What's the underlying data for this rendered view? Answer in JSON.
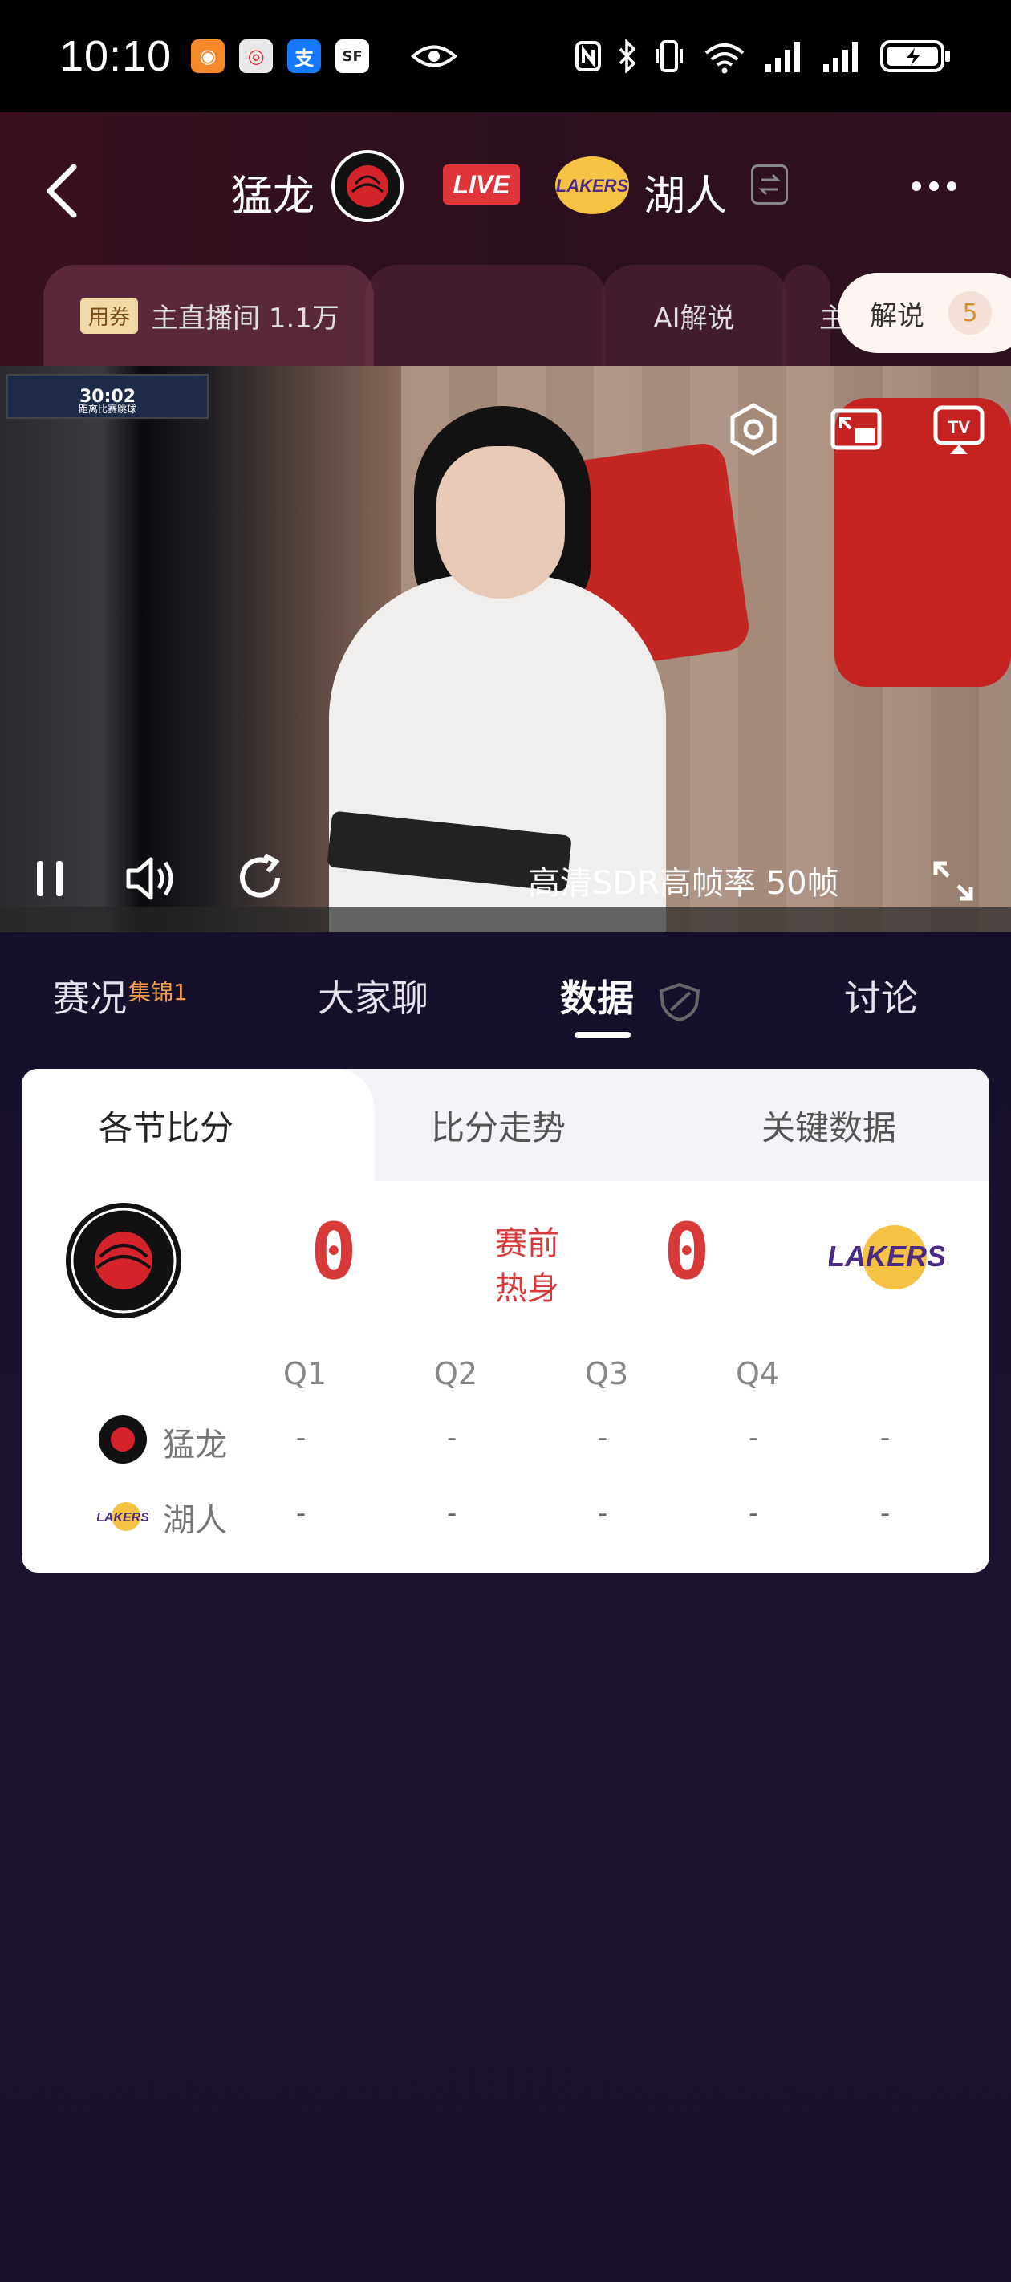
{
  "status_bar": {
    "time": "10:10",
    "notifications": [
      "app-icon-1",
      "weibo-icon",
      "alipay-icon",
      "sf-express-icon"
    ],
    "eye_icon": "eye-icon",
    "system_icons": [
      "nfc-icon",
      "bluetooth-icon",
      "vibrate-icon",
      "wifi-6-icon",
      "signal-icon",
      "signal-icon",
      "battery-charging-icon"
    ]
  },
  "header": {
    "home_team": "猛龙",
    "away_team": "湖人",
    "live_label": "LIVE",
    "raptors_logo_text": "TORONTO RAPTORS",
    "lakers_logo_text": "LAKERS"
  },
  "room_tabs": {
    "coupon": "用券",
    "main_room": "主直播间 1.1万",
    "ai": "AI解说",
    "partial": "主",
    "commentary": "解说",
    "commentary_count": "5"
  },
  "video": {
    "scorebug_clock": "30:02",
    "scorebug_sub": "距离比赛跳球",
    "quality": "高清SDR高帧率 50帧"
  },
  "content_tabs": [
    {
      "label": "赛况",
      "badge": "集锦1"
    },
    {
      "label": "大家聊"
    },
    {
      "label": "数据",
      "active": true
    },
    {
      "label": "讨论"
    }
  ],
  "scoreboard": {
    "tabs": [
      "各节比分",
      "比分走势",
      "关键数据"
    ],
    "home_score": "0",
    "away_score": "0",
    "status_line1": "赛前",
    "status_line2": "热身",
    "quarters": [
      "Q1",
      "Q2",
      "Q3",
      "Q4"
    ],
    "rows": [
      {
        "team": "猛龙",
        "q1": "-",
        "q2": "-",
        "q3": "-",
        "q4": "-",
        "total": "-"
      },
      {
        "team": "湖人",
        "q1": "-",
        "q2": "-",
        "q3": "-",
        "q4": "-",
        "total": "-"
      }
    ]
  },
  "colors": {
    "accent_red": "#d83a3a",
    "live_red": "#e0353a",
    "commentary_orange": "#d98f2f",
    "tab_badge_orange": "#f49a4a"
  }
}
